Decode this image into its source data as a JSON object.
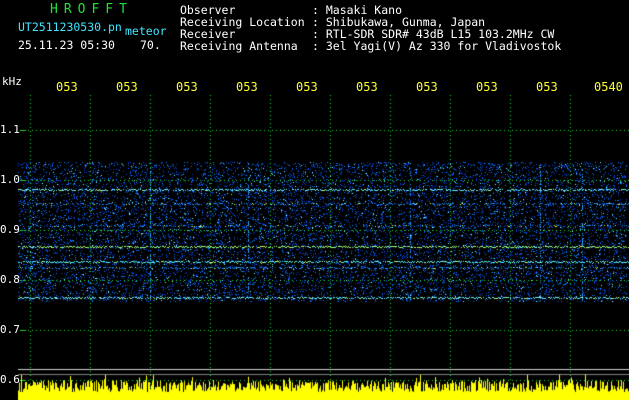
{
  "header": {
    "brand": "HROFFT",
    "filename": "UT2511230530.pn",
    "mode": "meteor",
    "datetime": "25.11.23 05:30",
    "count": "70.",
    "labels": {
      "observer": "Observer",
      "location": "Receiving Location",
      "receiver": "Receiver",
      "antenna": "Receiving Antenna"
    },
    "values": {
      "observer": ": Masaki Kano",
      "location": ": Shibukawa, Gunma, Japan",
      "receiver": ": RTL-SDR SDR# 43dB L15 103.2MHz CW",
      "antenna": ": 3el Yagi(V) Az 330 for Vladivostok"
    }
  },
  "axes": {
    "y_unit": "kHz",
    "y_ticks": [
      "1.1",
      "1.0",
      "0.9",
      "0.8",
      "0.7",
      "0.6"
    ],
    "x_ticks": [
      "053",
      "053",
      "053",
      "053",
      "053",
      "053",
      "053",
      "053",
      "053",
      "0540"
    ]
  },
  "colors": {
    "header_green": "#22e03a",
    "header_cyan": "#43e4ff",
    "tick_yellow": "#ffff33",
    "grid_green": "#1fd62a",
    "signal_band": "#00c8ff",
    "noise_floor": "#ffff00"
  }
}
